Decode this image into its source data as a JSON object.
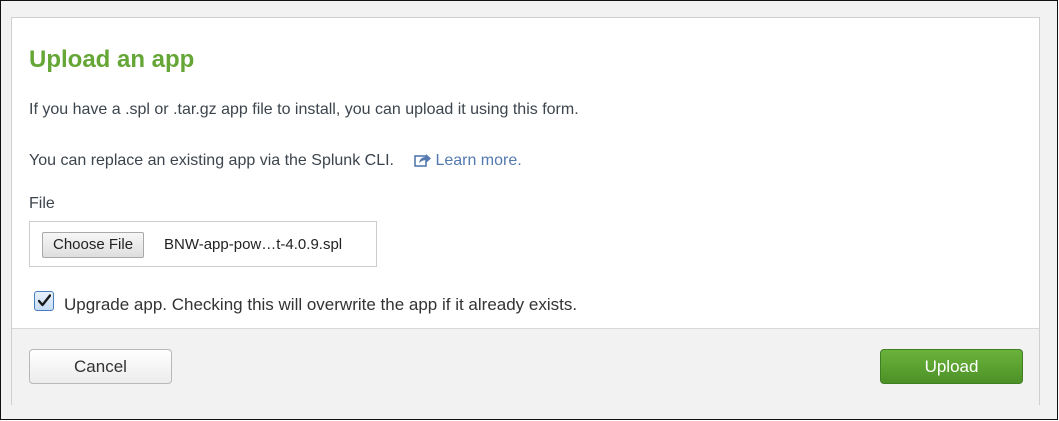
{
  "dialog": {
    "title": "Upload an app",
    "intro_text": "If you have a .spl or .tar.gz app file to install, you can upload it using this form.",
    "cli_text": "You can replace an existing app via the Splunk CLI.",
    "learn_more_label": "Learn more.",
    "learn_more_icon": "external-link-icon",
    "accent_color": "#65a637",
    "link_color": "#5379af"
  },
  "file_field": {
    "label": "File",
    "choose_button_label": "Choose File",
    "selected_file": "BNW-app-pow…t-4.0.9.spl"
  },
  "upgrade_option": {
    "checked": true,
    "label": "Upgrade app. Checking this will overwrite the app if it already exists."
  },
  "footer": {
    "cancel_label": "Cancel",
    "upload_label": "Upload",
    "upload_color": "#5ca332"
  }
}
